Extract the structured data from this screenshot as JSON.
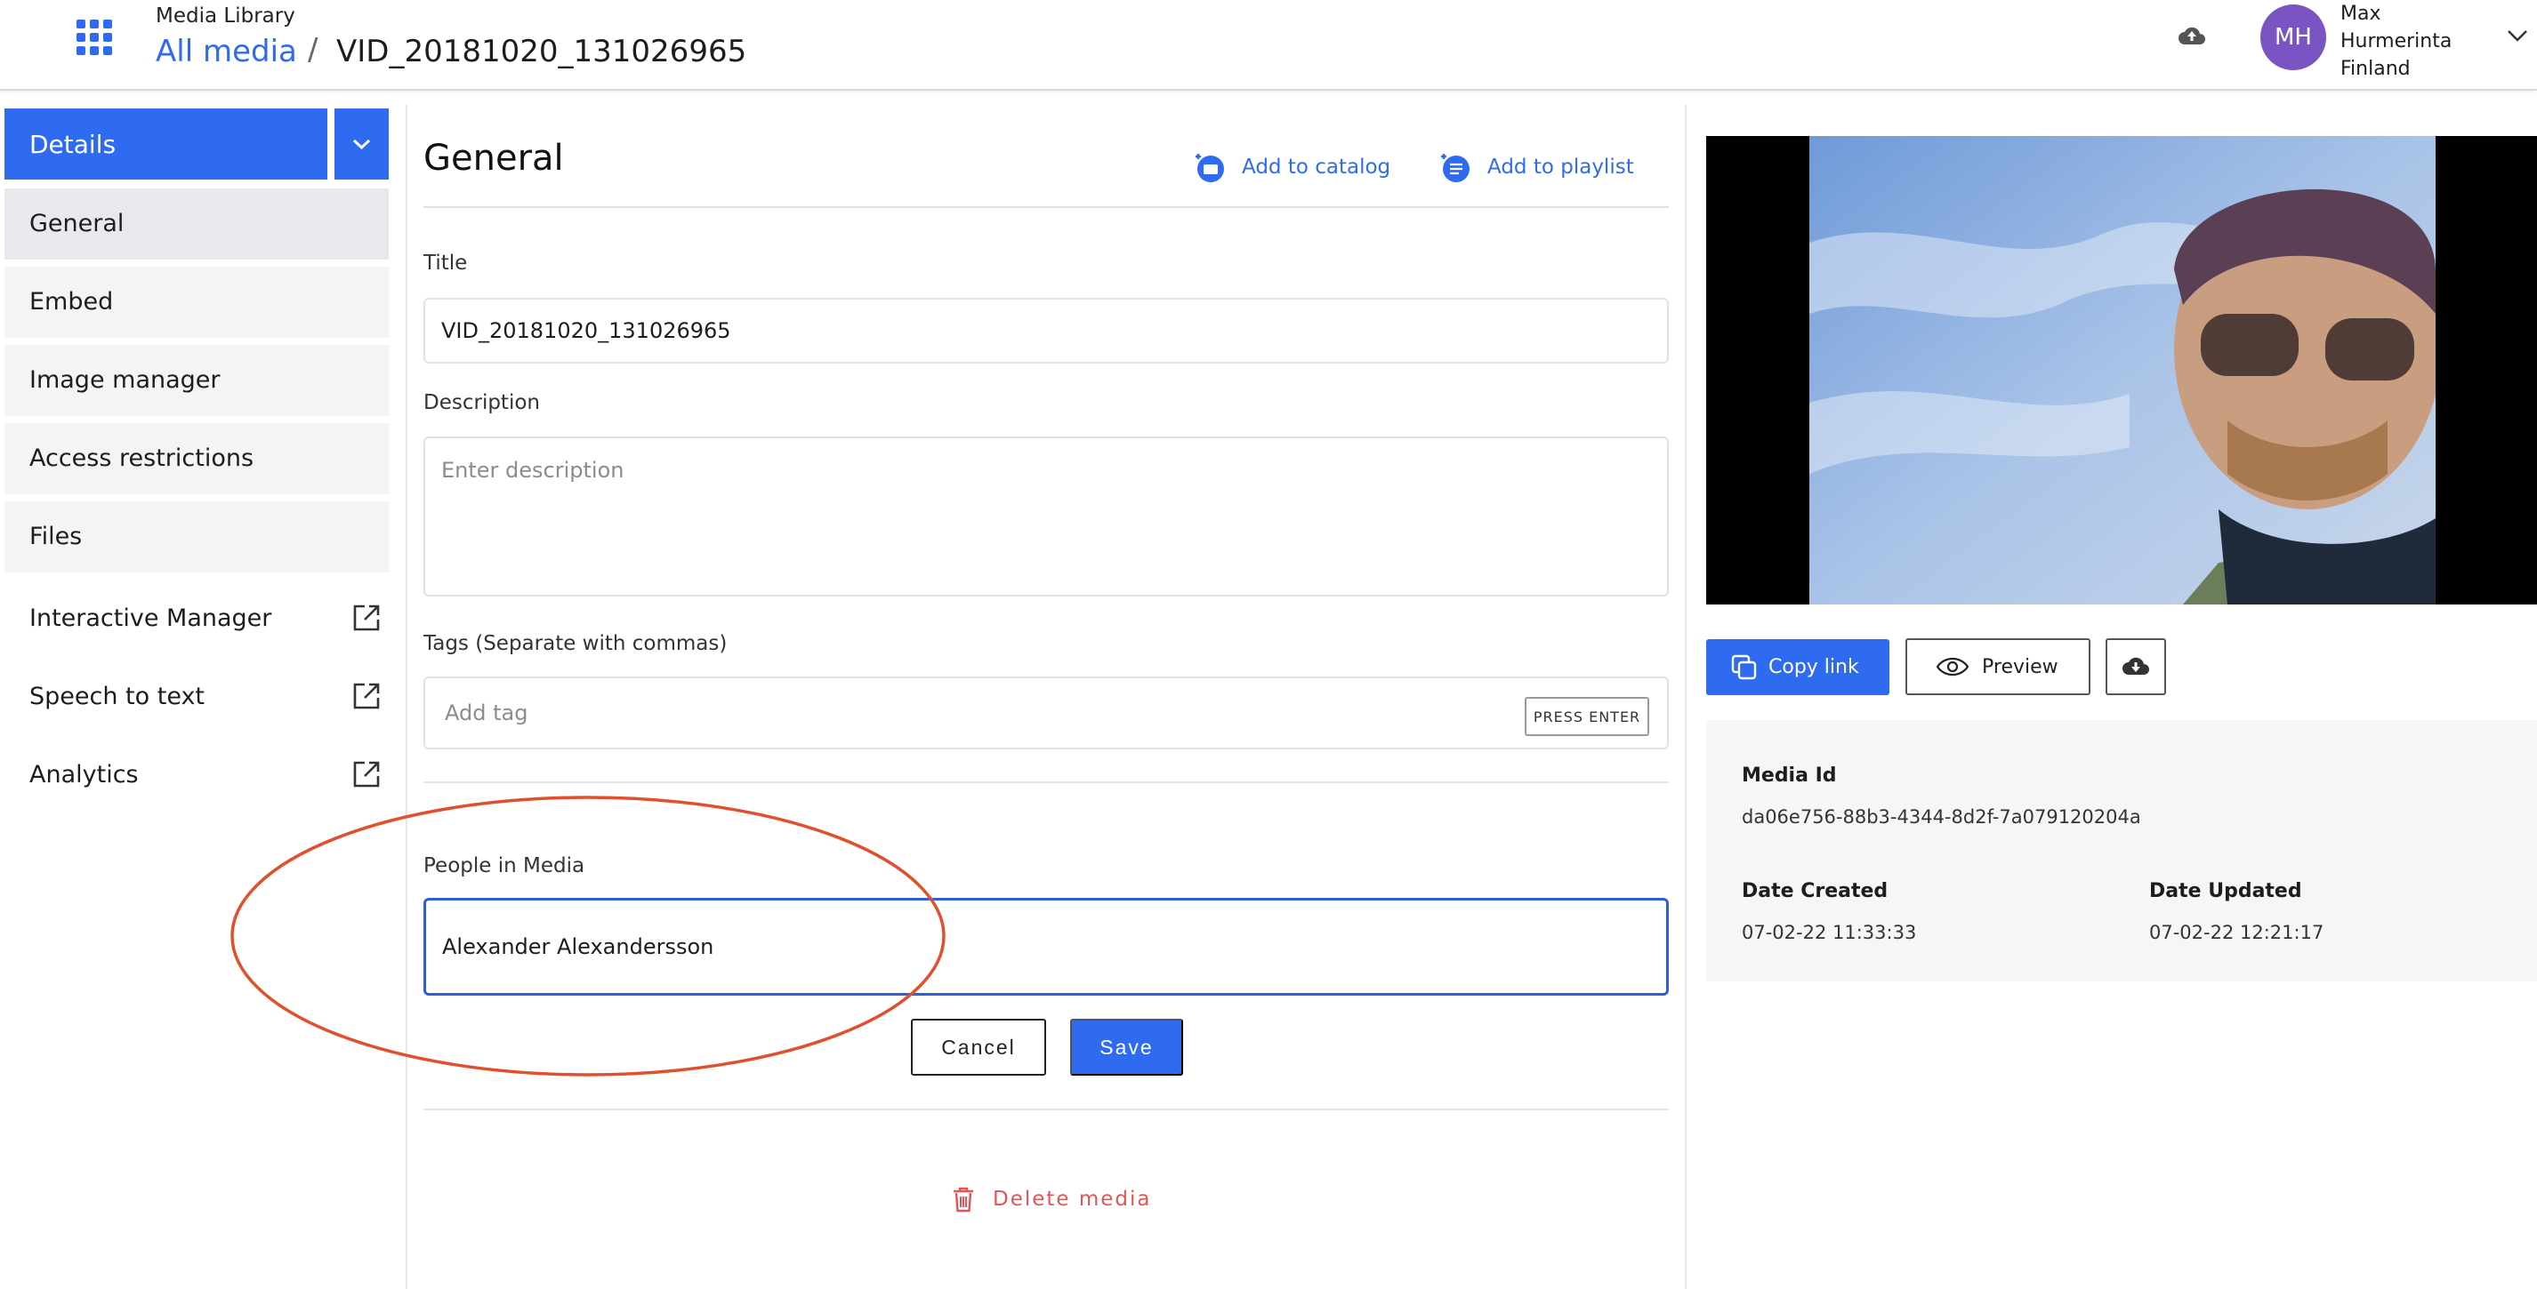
{
  "header": {
    "app_name": "Media Library",
    "breadcrumb_root": "All media",
    "breadcrumb_sep": "/",
    "breadcrumb_current": "VID_20181020_131026965",
    "user": {
      "initials": "MH",
      "first_name": "Max",
      "last_name": "Hurmerinta",
      "location": "Finland"
    }
  },
  "sidebar": {
    "dropdown_label": "Details",
    "items": [
      {
        "label": "General"
      },
      {
        "label": "Embed"
      },
      {
        "label": "Image manager"
      },
      {
        "label": "Access restrictions"
      },
      {
        "label": "Files"
      }
    ],
    "external_links": [
      {
        "label": "Interactive Manager"
      },
      {
        "label": "Speech to text"
      },
      {
        "label": "Analytics"
      }
    ]
  },
  "form": {
    "heading": "General",
    "add_to_catalog": "Add to catalog",
    "add_to_playlist": "Add to playlist",
    "title_label": "Title",
    "title_value": "VID_20181020_131026965",
    "description_label": "Description",
    "description_placeholder": "Enter description",
    "tags_label": "Tags (Separate with commas)",
    "tags_placeholder": "Add tag",
    "tags_hint": "PRESS ENTER",
    "people_label": "People in Media",
    "people_value": "Alexander Alexandersson",
    "cancel_label": "Cancel",
    "save_label": "Save",
    "delete_label": "Delete media"
  },
  "media": {
    "copy_link_label": "Copy link",
    "preview_label": "Preview",
    "media_id_label": "Media Id",
    "media_id_value": "da06e756-88b3-4344-8d2f-7a079120204a",
    "date_created_label": "Date Created",
    "date_created_value": "07-02-22 11:33:33",
    "date_updated_label": "Date Updated",
    "date_updated_value": "07-02-22 12:21:17"
  },
  "colors": {
    "accent": "#2f6bf0",
    "avatar": "#7b54c3",
    "danger": "#e25555",
    "annotation": "#e0502e"
  },
  "icons": [
    "apps-grid-icon",
    "cloud-upload-icon",
    "chevron-down-icon",
    "external-link-icon",
    "catalog-add-icon",
    "playlist-add-icon",
    "copy-icon",
    "eye-icon",
    "cloud-download-icon",
    "trash-icon"
  ]
}
